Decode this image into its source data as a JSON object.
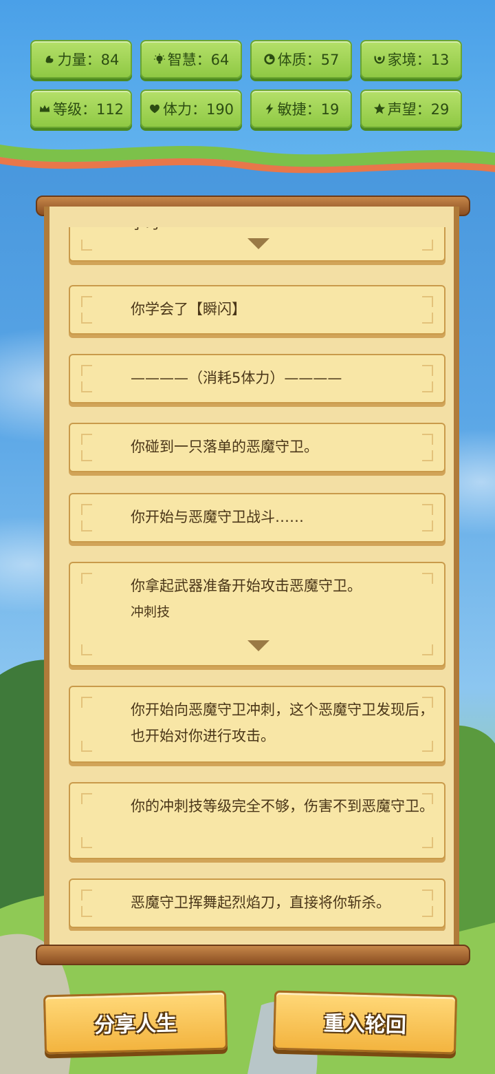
{
  "stats": [
    {
      "icon": "strength-icon",
      "label": "力量：84"
    },
    {
      "icon": "bulb-icon",
      "label": "智慧：64"
    },
    {
      "icon": "body-icon",
      "label": "体质：57"
    },
    {
      "icon": "family-icon",
      "label": "家境：13"
    },
    {
      "icon": "crown-icon",
      "label": "等级：112"
    },
    {
      "icon": "heart-icon",
      "label": "体力：190"
    },
    {
      "icon": "bolt-icon",
      "label": "敏捷：19"
    },
    {
      "icon": "star-icon",
      "label": "声望：29"
    }
  ],
  "log": {
    "entries": [
      {
        "text": "学习"
      },
      {
        "text": "你学会了【瞬闪】"
      },
      {
        "text": "————（消耗5体力）————"
      },
      {
        "text": "你碰到一只落单的恶魔守卫。"
      },
      {
        "text": "你开始与恶魔守卫战斗……"
      },
      {
        "text": "你拿起武器准备开始攻击恶魔守卫。",
        "sub": "冲刺技"
      },
      {
        "text": "你开始向恶魔守卫冲刺，这个恶魔守卫发现后，也开始对你进行攻击。"
      },
      {
        "text": "你的冲刺技等级完全不够，伤害不到恶魔守卫。"
      },
      {
        "text": "恶魔守卫挥舞起烈焰刀，直接将你斩杀。"
      }
    ]
  },
  "buttons": {
    "share": "分享人生",
    "rebirth": "重入轮回"
  },
  "colors": {
    "stat_green": "#8fc944",
    "card_bg": "#f8e6a6",
    "button_gold": "#f3b43f"
  }
}
